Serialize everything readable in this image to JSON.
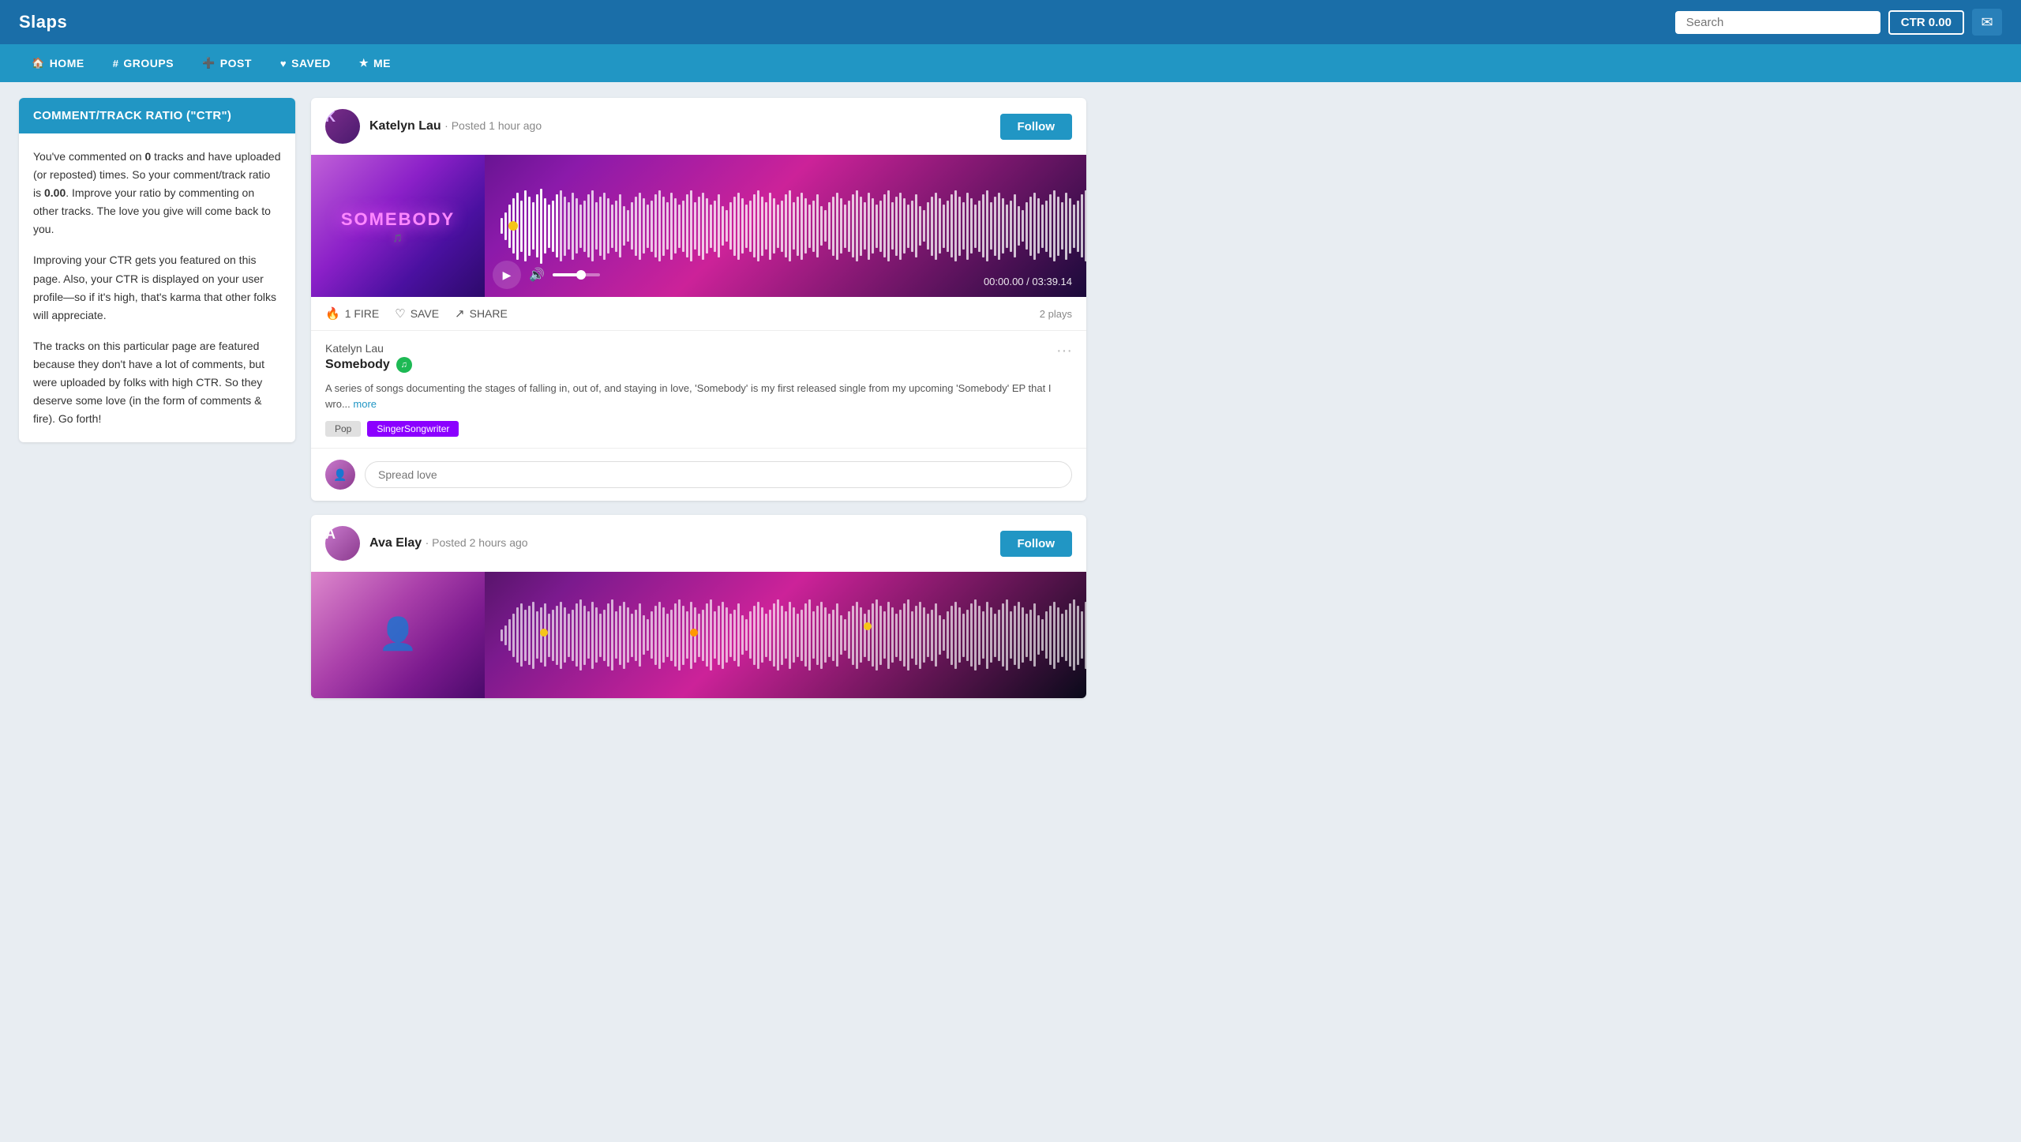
{
  "app": {
    "logo": "Slaps",
    "ctr_label": "CTR 0.00",
    "search_placeholder": "Search",
    "mail_icon": "✉"
  },
  "nav": {
    "items": [
      {
        "id": "home",
        "icon": "🏠",
        "label": "HOME"
      },
      {
        "id": "groups",
        "icon": "#",
        "label": "GROUPS"
      },
      {
        "id": "post",
        "icon": "➕",
        "label": "POST"
      },
      {
        "id": "saved",
        "icon": "♥",
        "label": "SAVED"
      },
      {
        "id": "me",
        "icon": "★",
        "label": "ME"
      }
    ]
  },
  "sidebar": {
    "ctr_title": "COMMENT/TRACK RATIO (\"CTR\")",
    "para1_prefix": "You've commented on ",
    "para1_bold1": "0",
    "para1_mid": " tracks and have uploaded (or reposted) times. So your comment/track ratio is ",
    "para1_bold2": "0.00",
    "para1_suffix": ". Improve your ratio by commenting on other tracks. The love you give will come back to you.",
    "para2": "Improving your CTR gets you featured on this page. Also, your CTR is displayed on your user profile—so if it's high, that's karma that other folks will appreciate.",
    "para3": "The tracks on this particular page are featured because they don't have a lot of comments, but were uploaded by folks with high CTR. So they deserve some love (in the form of comments & fire). Go forth!"
  },
  "tracks": [
    {
      "id": "track1",
      "user_name": "Katelyn Lau",
      "posted_time": "· Posted 1 hour ago",
      "follow_label": "Follow",
      "fire_label": "1 FIRE",
      "save_label": "SAVE",
      "share_label": "SHARE",
      "plays": "2 plays",
      "artist": "Katelyn Lau",
      "title": "Somebody",
      "description": "A series of songs documenting the stages of falling in, out of, and staying in love, 'Somebody' is my first released single from my upcoming 'Somebody' EP that I wro...",
      "more_label": "more",
      "tags": [
        "Pop",
        "SingerSongwriter"
      ],
      "time_current": "00:00.00",
      "time_total": "03:39.14",
      "album_art_text": "SOMEBODY",
      "comment_placeholder": "Spread love",
      "options_icon": "···"
    },
    {
      "id": "track2",
      "user_name": "Ava Elay",
      "posted_time": "· Posted 2 hours ago",
      "follow_label": "Follow"
    }
  ],
  "colors": {
    "primary": "#2196c4",
    "nav_bg": "#2196c4",
    "top_bar_bg": "#1a6ea8",
    "tag_singer_bg": "#8b00ff"
  }
}
